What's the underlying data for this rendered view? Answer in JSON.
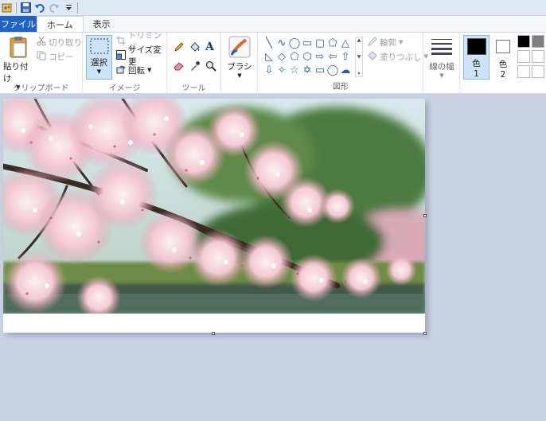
{
  "window": {
    "quick_access": [
      "paint-app-icon",
      "save-icon",
      "undo-icon",
      "redo-icon",
      "customize-qat-icon"
    ]
  },
  "tabs": {
    "file": "ファイル",
    "home": "ホーム",
    "view": "表示"
  },
  "ribbon": {
    "clipboard": {
      "paste": "貼り付け",
      "cut": "切り取り",
      "copy": "コピー",
      "label": "クリップボード"
    },
    "image": {
      "select": "選択",
      "crop": "トリミング",
      "resize": "サイズ変更",
      "rotate": "回転",
      "label": "イメージ"
    },
    "tools": {
      "label": "ツール"
    },
    "brushes": {
      "label": "ブラシ"
    },
    "shapes": {
      "outline": "輪郭",
      "fill": "塗りつぶし",
      "label": "図形"
    },
    "size": {
      "label": "線の幅"
    },
    "color1": {
      "label_line1": "色",
      "label_line2": "1"
    },
    "color2": {
      "label_line1": "色",
      "label_line2": "2"
    }
  },
  "colors": {
    "accent": "#1f63c4",
    "color1": "#000000",
    "color2": "#ffffff",
    "palette": [
      "#000000",
      "#7f7f7f",
      "#ffffff",
      "#ffffff",
      "#ffffff",
      "#ffffff"
    ]
  },
  "canvas": {
    "content": "cherry-blossom-photo"
  }
}
